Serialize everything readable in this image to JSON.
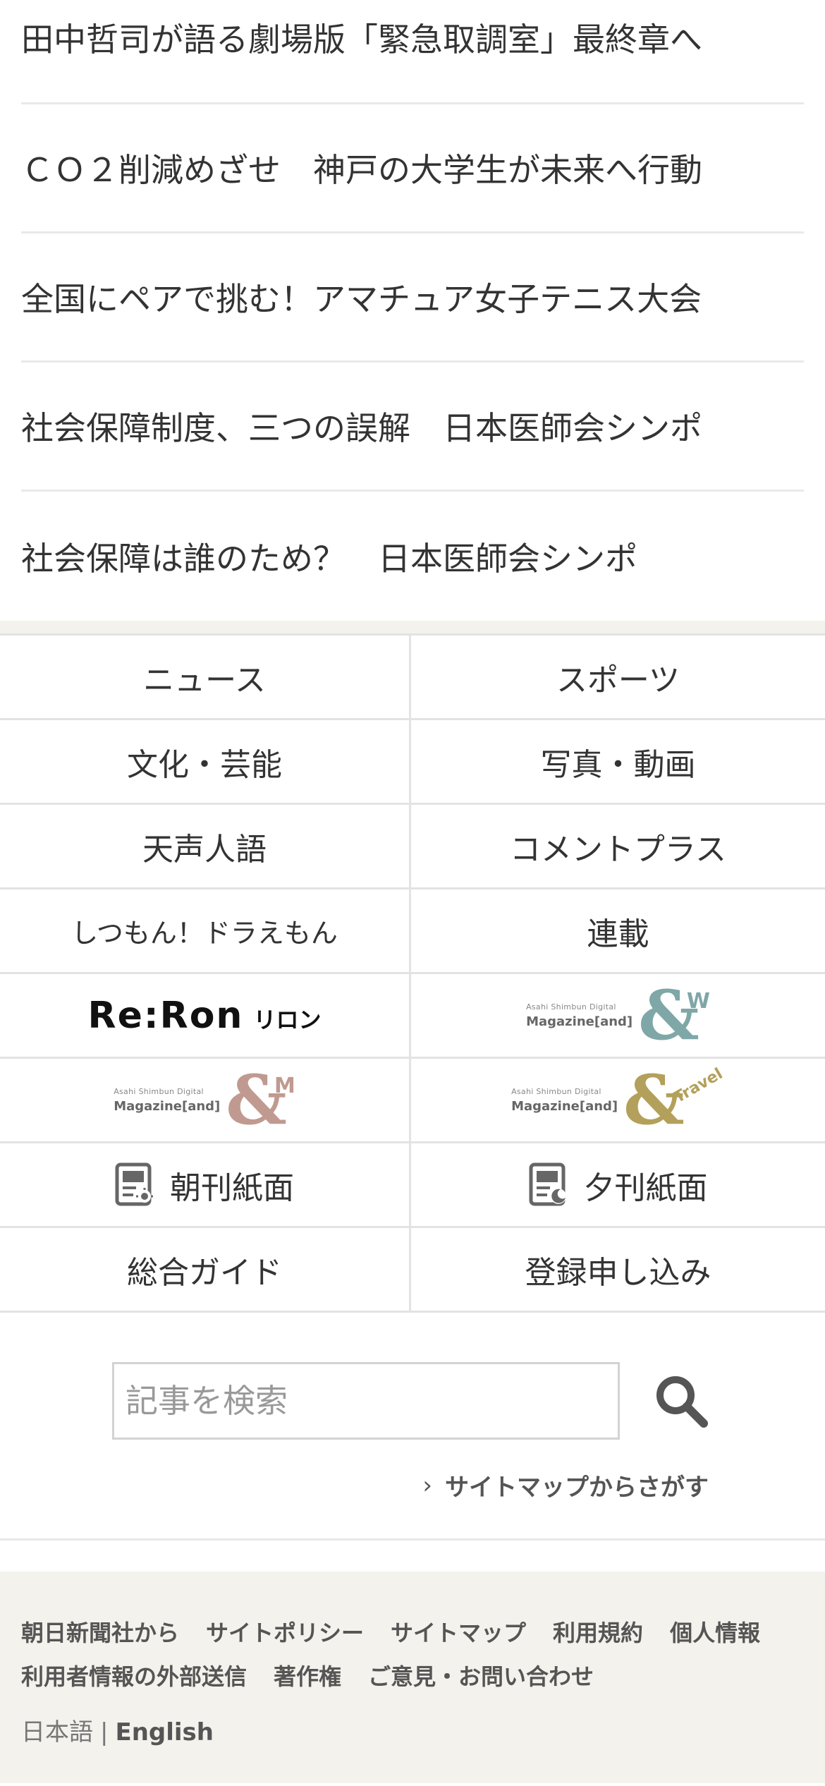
{
  "articles": [
    "田中哲司が語る劇場版「緊急取調室」最終章へ",
    "ＣＯ２削減めざせ　神戸の大学生が未来へ行動",
    "全国にペアで挑む！アマチュア女子テニス大会",
    "社会保障制度、三つの誤解　日本医師会シンポ",
    "社会保障は誰のため？　日本医師会シンポ"
  ],
  "menu": {
    "news": "ニュース",
    "sports": "スポーツ",
    "culture": "文化・芸能",
    "photo": "写真・動画",
    "tenseijingo": "天声人語",
    "commentplus": "コメントプラス",
    "doraemon": "しつもん！ドラえもん",
    "rensai": "連載",
    "reron_logo": "Re:Ron",
    "reron_kana": "リロン",
    "mag_top": "Asahi Shimbun Digital",
    "mag_name": "Magazine[and]",
    "andw_letter": "W",
    "andm_letter": "M",
    "andtravel_letter": "Travel",
    "morning": "朝刊紙面",
    "evening": "夕刊紙面",
    "guide": "総合ガイド",
    "register": "登録申し込み",
    "colors": {
      "andw": "#7fa7a7",
      "andm": "#c09a90",
      "andtravel": "#b3a05a"
    }
  },
  "search": {
    "placeholder": "記事を検索",
    "sitemap_link": "サイトマップからさがす"
  },
  "footer": {
    "links": [
      "朝日新聞社から",
      "サイトポリシー",
      "サイトマップ",
      "利用規約",
      "個人情報",
      "利用者情報の外部送信",
      "著作権",
      "ご意見・お問い合わせ"
    ],
    "lang_ja": "日本語",
    "lang_sep": "|",
    "lang_en": "English"
  }
}
